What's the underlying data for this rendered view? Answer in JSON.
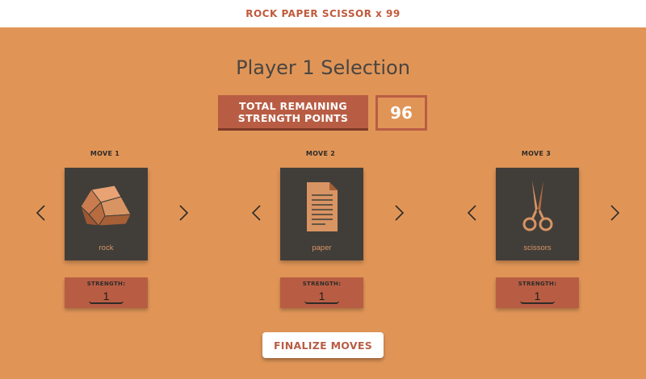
{
  "header": {
    "title": "ROCK PAPER SCISSOR x 99"
  },
  "page_title": "Player 1 Selection",
  "points": {
    "label_line1": "TOTAL REMAINING",
    "label_line2": "STRENGTH POINTS",
    "value": "96"
  },
  "moves": [
    {
      "label": "MOVE 1",
      "choice": "rock",
      "icon": "rock-icon",
      "strength_label": "STRENGTH:",
      "strength": "1"
    },
    {
      "label": "MOVE 2",
      "choice": "paper",
      "icon": "paper-icon",
      "strength_label": "STRENGTH:",
      "strength": "1"
    },
    {
      "label": "MOVE 3",
      "choice": "scissors",
      "icon": "scissors-icon",
      "strength_label": "STRENGTH:",
      "strength": "1"
    }
  ],
  "finalize_label": "FINALIZE MOVES",
  "colors": {
    "background": "#E09557",
    "accent": "#B85D44",
    "card": "#413E39",
    "icon": "#D99463"
  }
}
